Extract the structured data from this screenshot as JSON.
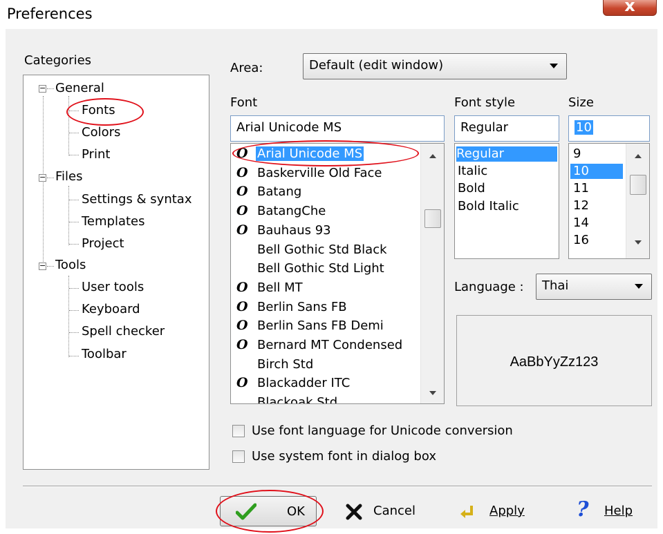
{
  "window": {
    "title": "Preferences",
    "close_symbol": "x"
  },
  "categories": {
    "label": "Categories",
    "groups": [
      {
        "label": "General",
        "expander": "−",
        "items": [
          "Fonts",
          "Colors",
          "Print"
        ]
      },
      {
        "label": "Files",
        "expander": "−",
        "items": [
          "Settings & syntax",
          "Templates",
          "Project"
        ]
      },
      {
        "label": "Tools",
        "expander": "−",
        "items": [
          "User tools",
          "Keyboard",
          "Spell checker",
          "Toolbar"
        ]
      }
    ]
  },
  "area": {
    "label": "Area:",
    "value": "Default (edit window)"
  },
  "font": {
    "label": "Font",
    "value": "Arial Unicode MS",
    "opentype_glyph": "O",
    "items": [
      {
        "name": "Arial Unicode MS",
        "opentype": true,
        "selected": true
      },
      {
        "name": "Baskerville Old Face",
        "opentype": true
      },
      {
        "name": "Batang",
        "opentype": true
      },
      {
        "name": "BatangChe",
        "opentype": true
      },
      {
        "name": "Bauhaus 93",
        "opentype": true
      },
      {
        "name": "Bell Gothic Std Black",
        "opentype": false
      },
      {
        "name": "Bell Gothic Std Light",
        "opentype": false
      },
      {
        "name": "Bell MT",
        "opentype": true
      },
      {
        "name": "Berlin Sans FB",
        "opentype": true
      },
      {
        "name": "Berlin Sans FB Demi",
        "opentype": true
      },
      {
        "name": "Bernard MT Condensed",
        "opentype": true
      },
      {
        "name": "Birch Std",
        "opentype": false
      },
      {
        "name": "Blackadder ITC",
        "opentype": true
      },
      {
        "name": "Blackoak Std",
        "opentype": false
      }
    ]
  },
  "font_style": {
    "label": "Font style",
    "value": "Regular",
    "items": [
      "Regular",
      "Italic",
      "Bold",
      "Bold Italic"
    ],
    "selected": "Regular"
  },
  "size": {
    "label": "Size",
    "value": "10",
    "items": [
      "9",
      "10",
      "11",
      "12",
      "14",
      "16"
    ],
    "selected": "10"
  },
  "language": {
    "label": "Language :",
    "value": "Thai"
  },
  "preview": {
    "text": "AaBbYyZz123"
  },
  "options": {
    "unicode_conversion": {
      "label": "Use font language for Unicode conversion",
      "checked": false
    },
    "system_font": {
      "label": "Use system font in dialog box",
      "checked": false
    }
  },
  "buttons": {
    "ok": "OK",
    "cancel": "Cancel",
    "apply": "Apply",
    "help": "Help"
  },
  "colors": {
    "selection": "#3399ff",
    "annotation": "#e0101a",
    "ok_check": "#2f9e1f",
    "cancel_x": "#101010",
    "apply_arrow": "#d6b11a",
    "help_q": "#1e4fd6"
  }
}
